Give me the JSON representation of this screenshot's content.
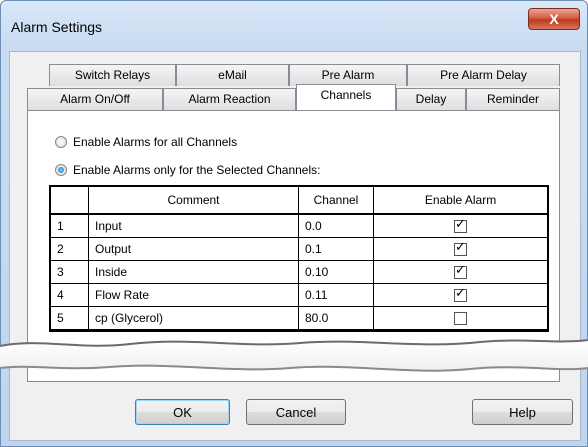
{
  "window": {
    "title": "Alarm Settings",
    "close_glyph": "X"
  },
  "tabs_row1": [
    "Switch Relays",
    "eMail",
    "Pre Alarm",
    "Pre Alarm Delay"
  ],
  "tabs_row2": [
    "Alarm On/Off",
    "Alarm Reaction",
    "Channels",
    "Delay",
    "Reminder"
  ],
  "active_tab": "Channels",
  "radios": [
    {
      "label": "Enable Alarms for all Channels",
      "selected": false
    },
    {
      "label": "Enable Alarms only for the Selected Channels:",
      "selected": true
    }
  ],
  "grid": {
    "headers": [
      "",
      "Comment",
      "Channel",
      "Enable Alarm"
    ],
    "rows": [
      {
        "num": "1",
        "comment": "Input",
        "channel": "0.0",
        "enabled": true
      },
      {
        "num": "2",
        "comment": "Output",
        "channel": "0.1",
        "enabled": true
      },
      {
        "num": "3",
        "comment": "Inside",
        "channel": "0.10",
        "enabled": true
      },
      {
        "num": "4",
        "comment": "Flow Rate",
        "channel": "0.11",
        "enabled": true
      },
      {
        "num": "5",
        "comment": "cp (Glycerol)",
        "channel": "80.0",
        "enabled": false
      }
    ]
  },
  "buttons": {
    "ok": "OK",
    "cancel": "Cancel",
    "help": "Help"
  }
}
